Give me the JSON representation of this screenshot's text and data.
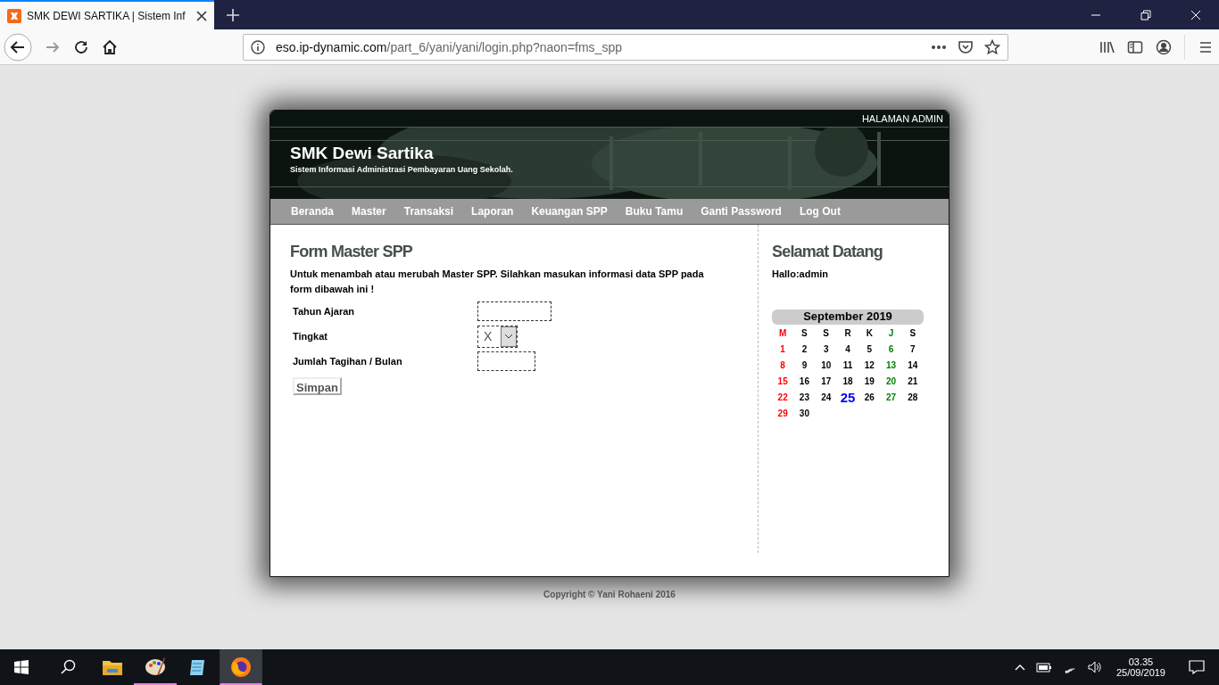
{
  "browser": {
    "tab": {
      "title": "SMK DEWI SARTIKA | Sistem Inf",
      "selected": true
    },
    "url": {
      "host": "eso.ip-dynamic.com",
      "path": "/part_6/yani/yani/login.php?naon=fms_spp"
    }
  },
  "top_strip": {
    "label": "HALAMAN ADMIN"
  },
  "header": {
    "title": "SMK Dewi Sartika",
    "subtitle": "Sistem Informasi Administrasi Pembayaran Uang Sekolah."
  },
  "nav": [
    "Beranda",
    "Master",
    "Transaksi",
    "Laporan",
    "Keuangan SPP",
    "Buku Tamu",
    "Ganti Password",
    "Log Out"
  ],
  "form": {
    "title": "Form Master SPP",
    "intro": "Untuk menambah atau merubah Master SPP. Silahkan masukan informasi data SPP pada form dibawah ini !",
    "fields": [
      {
        "label": "Tahun Ajaran",
        "kind": "text"
      },
      {
        "label": "Tingkat",
        "kind": "select",
        "value": "X"
      },
      {
        "label": "Jumlah Tagihan / Bulan",
        "kind": "short"
      }
    ],
    "submit": "Simpan"
  },
  "sidebar": {
    "title": "Selamat Datang",
    "greeting": "Hallo:admin",
    "calendar": {
      "month": "September 2019",
      "weekdays": [
        {
          "label": "M",
          "color": "#ff0000"
        },
        {
          "label": "S",
          "color": "#000000"
        },
        {
          "label": "S",
          "color": "#000000"
        },
        {
          "label": "R",
          "color": "#000000"
        },
        {
          "label": "K",
          "color": "#000000"
        },
        {
          "label": "J",
          "color": "#008000"
        },
        {
          "label": "S",
          "color": "#000000"
        }
      ],
      "weeks": [
        [
          {
            "day": "1",
            "color": "#ff0000",
            "selected": false
          },
          {
            "day": "2",
            "selected": false
          },
          {
            "day": "3",
            "selected": false
          },
          {
            "day": "4",
            "selected": false
          },
          {
            "day": "5",
            "selected": false
          },
          {
            "day": "6",
            "color": "#008000",
            "selected": false
          },
          {
            "day": "7",
            "selected": false
          }
        ],
        [
          {
            "day": "8",
            "color": "#ff0000",
            "selected": false
          },
          {
            "day": "9",
            "selected": false
          },
          {
            "day": "10",
            "selected": false
          },
          {
            "day": "11",
            "selected": false
          },
          {
            "day": "12",
            "selected": false
          },
          {
            "day": "13",
            "color": "#008000",
            "selected": false
          },
          {
            "day": "14",
            "selected": false
          }
        ],
        [
          {
            "day": "15",
            "color": "#ff0000",
            "selected": false
          },
          {
            "day": "16",
            "selected": false
          },
          {
            "day": "17",
            "selected": false
          },
          {
            "day": "18",
            "selected": false
          },
          {
            "day": "19",
            "selected": false
          },
          {
            "day": "20",
            "color": "#008000",
            "selected": false
          },
          {
            "day": "21",
            "selected": false
          }
        ],
        [
          {
            "day": "22",
            "color": "#ff0000",
            "selected": false
          },
          {
            "day": "23",
            "selected": false
          },
          {
            "day": "24",
            "selected": false
          },
          {
            "day": "25",
            "color": "#0000ff",
            "selected": true
          },
          {
            "day": "26",
            "selected": false
          },
          {
            "day": "27",
            "color": "#008000",
            "selected": false
          },
          {
            "day": "28",
            "selected": false
          }
        ],
        [
          {
            "day": "29",
            "color": "#ff0000",
            "selected": false
          },
          {
            "day": "30",
            "selected": false
          }
        ]
      ]
    }
  },
  "footer": "Copyright © Yani Rohaeni 2016",
  "taskbar": {
    "apps": [
      {
        "kind": "folder",
        "running": false,
        "selected": false
      },
      {
        "kind": "paint",
        "running": true,
        "selected": false
      },
      {
        "kind": "notepad",
        "running": false,
        "selected": false
      },
      {
        "kind": "firefox",
        "running": true,
        "selected": true
      }
    ],
    "time": "03.35",
    "date": "25/09/2019"
  }
}
